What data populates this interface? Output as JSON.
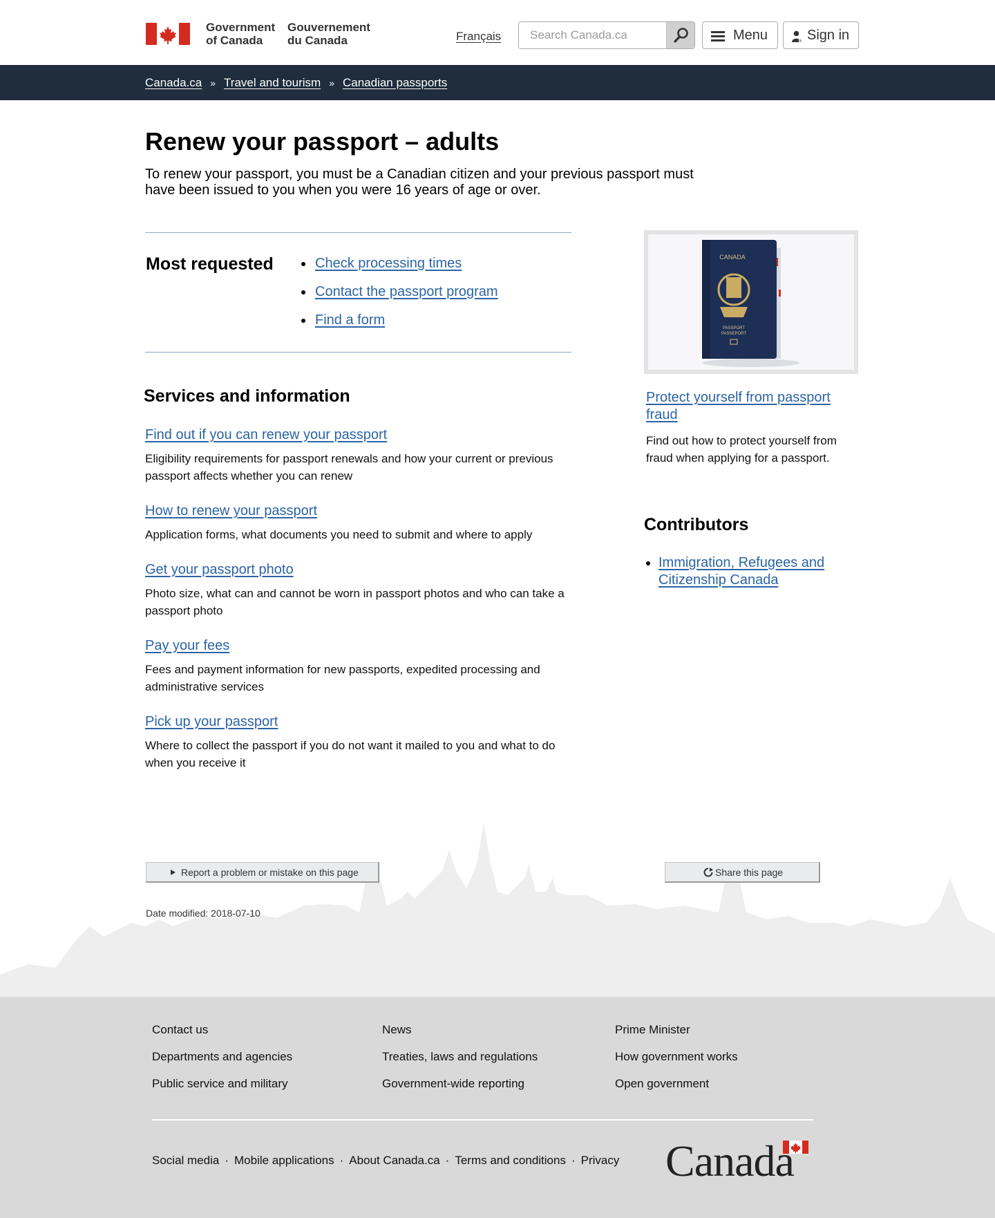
{
  "header": {
    "gov_en_line1": "Government",
    "gov_en_line2": "of Canada",
    "gov_fr_line1": "Gouvernement",
    "gov_fr_line2": "du Canada",
    "language_link": "Français",
    "search_placeholder": "Search Canada.ca",
    "menu_label": "Menu",
    "signin_label": "Sign in"
  },
  "breadcrumb": [
    "Canada.ca",
    "Travel and tourism",
    "Canadian passports"
  ],
  "breadcrumb_separator": "»",
  "main": {
    "title": "Renew your passport – adults",
    "intro": "To renew your passport, you must be a Canadian citizen and your previous passport must have been issued to you when you were 16 years of age or over.",
    "most_requested_title": "Most requested",
    "most_requested": [
      "Check processing times",
      "Contact the passport program",
      "Find a form"
    ],
    "services_title": "Services and information",
    "services": [
      {
        "title": "Find out if you can renew your passport",
        "desc": "Eligibility requirements for passport renewals and how your current or previous passport affects whether you can renew"
      },
      {
        "title": "How to renew your passport",
        "desc": "Application forms, what documents you need to submit and where to apply"
      },
      {
        "title": "Get your passport photo",
        "desc": "Photo size, what can and cannot be worn in passport photos and who can take a passport photo"
      },
      {
        "title": "Pay your fees",
        "desc": "Fees and payment information for new passports, expedited processing and administrative services"
      },
      {
        "title": "Pick up your passport",
        "desc": "Where to collect the passport if you do not want it mailed to you and what to do when you receive it"
      }
    ]
  },
  "sidebar": {
    "passport_cover_word_top": "CANADA",
    "passport_cover_word_1": "PASSPORT",
    "passport_cover_word_2": "PASSEPORT",
    "feature_link": "Protect yourself from passport fraud",
    "feature_desc": "Find out how to protect yourself from fraud when applying for a passport.",
    "contributors_title": "Contributors",
    "contributors": [
      "Immigration, Refugees and Citizenship Canada"
    ]
  },
  "page_actions": {
    "report_label": "Report a problem or mistake on this page",
    "share_label": "Share this page",
    "date_modified": "Date modified: 2018-07-10"
  },
  "footer": {
    "col1": [
      "Contact us",
      "Departments and agencies",
      "Public service and military"
    ],
    "col2": [
      "News",
      "Treaties, laws and regulations",
      "Government-wide reporting"
    ],
    "col3": [
      "Prime Minister",
      "How government works",
      "Open government"
    ],
    "bottom_links": [
      "Social media",
      "Mobile applications",
      "About Canada.ca",
      "Terms and conditions",
      "Privacy"
    ],
    "separator": "·",
    "wordmark": "Canada"
  },
  "colors": {
    "link": "#2b64a5",
    "breadcrumb_bar": "#1f2d3d",
    "flag_red": "#d52b1e",
    "footer_bg": "#d9d9d9",
    "rule": "#8aa6c1"
  },
  "icons": [
    "canada-flag-icon",
    "search-icon",
    "menu-icon",
    "user-icon",
    "play-triangle-icon",
    "share-icon"
  ]
}
